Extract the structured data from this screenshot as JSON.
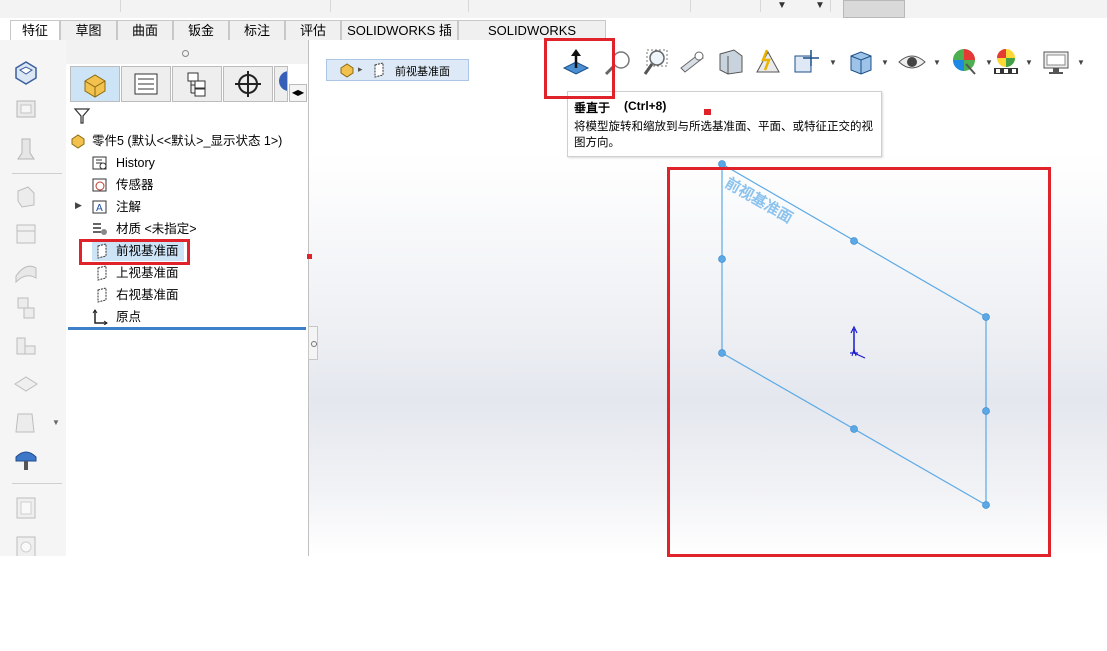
{
  "tabs": [
    {
      "label": "特征",
      "active": true
    },
    {
      "label": "草图"
    },
    {
      "label": "曲面"
    },
    {
      "label": "钣金"
    },
    {
      "label": "标注"
    },
    {
      "label": "评估"
    },
    {
      "label": "SOLIDWORKS 插件"
    },
    {
      "label": "SOLIDWORKS Inspection"
    }
  ],
  "command_icons": [
    "extruded-boss-icon",
    "revolved-boss-icon",
    "swept-boss-icon",
    "lofted-boss-icon",
    "boundary-boss-icon",
    "fillet-icon",
    "linear-pattern-icon",
    "rib-icon",
    "wrap-icon",
    "draft-icon",
    "shell-icon",
    "reference-geometry-icon",
    "curves-icon",
    "instant3d-icon"
  ],
  "feature_manager": {
    "tabs": [
      "feature-tree-tab",
      "property-manager-tab",
      "configuration-tab",
      "dimxpert-tab",
      "display-tab"
    ],
    "filter_icon": "filter-icon",
    "part_name": "零件5 (默认<<默认>_显示状态 1>)",
    "tree": [
      {
        "label": "History",
        "icon": "history-icon"
      },
      {
        "label": "传感器",
        "icon": "sensor-icon"
      },
      {
        "label": "注解",
        "icon": "annotation-icon",
        "expandable": true
      },
      {
        "label": "材质 <未指定>",
        "icon": "material-icon"
      },
      {
        "label": "前视基准面",
        "icon": "plane-icon",
        "selected": true
      },
      {
        "label": "上视基准面",
        "icon": "plane-icon"
      },
      {
        "label": "右视基准面",
        "icon": "plane-icon"
      },
      {
        "label": "原点",
        "icon": "origin-icon"
      }
    ]
  },
  "breadcrumb": {
    "label": "前视基准面"
  },
  "view_toolbar": [
    "normal-to-icon",
    "zoom-to-fit-icon",
    "zoom-to-area-icon",
    "previous-view-icon",
    "section-view-icon",
    "dynamic-annotation-icon",
    "view-orientation-icon",
    "display-style-icon",
    "hide-show-icon",
    "edit-appearance-icon",
    "apply-scene-icon",
    "view-settings-icon"
  ],
  "tooltip": {
    "title": "垂直于",
    "shortcut": "(Ctrl+8)",
    "description": "将模型旋转和缩放到与所选基准面、平面、或特征正交的视图方向。"
  },
  "viewport": {
    "plane_label": "前视基准面"
  },
  "colors": {
    "highlight": "#e0232b",
    "plane": "#5aa9e6",
    "selection": "#cde4f7"
  }
}
